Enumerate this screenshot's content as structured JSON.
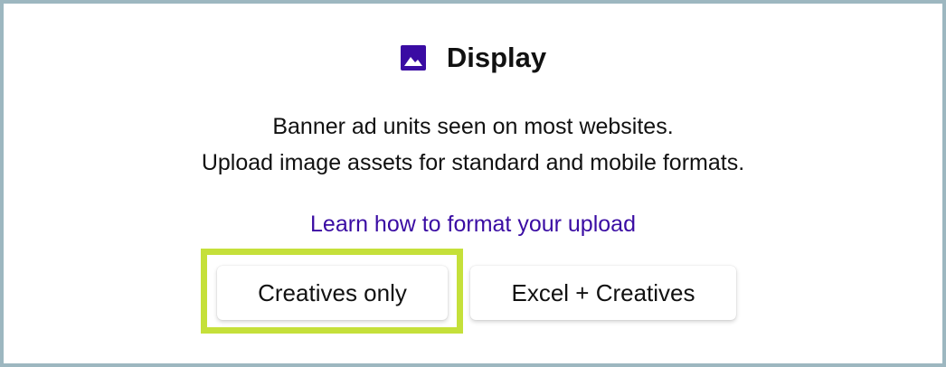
{
  "card": {
    "title": "Display",
    "icon": "image-icon",
    "description_line1": "Banner ad units seen on most websites.",
    "description_line2": "Upload image assets for standard and mobile formats.",
    "link_label": "Learn how to format your upload"
  },
  "buttons": {
    "creatives_only": "Creatives only",
    "excel_creatives": "Excel + Creatives"
  },
  "colors": {
    "accent": "#3a0ca3",
    "highlight": "#c5e03a",
    "frame_border": "#9db7c0"
  }
}
